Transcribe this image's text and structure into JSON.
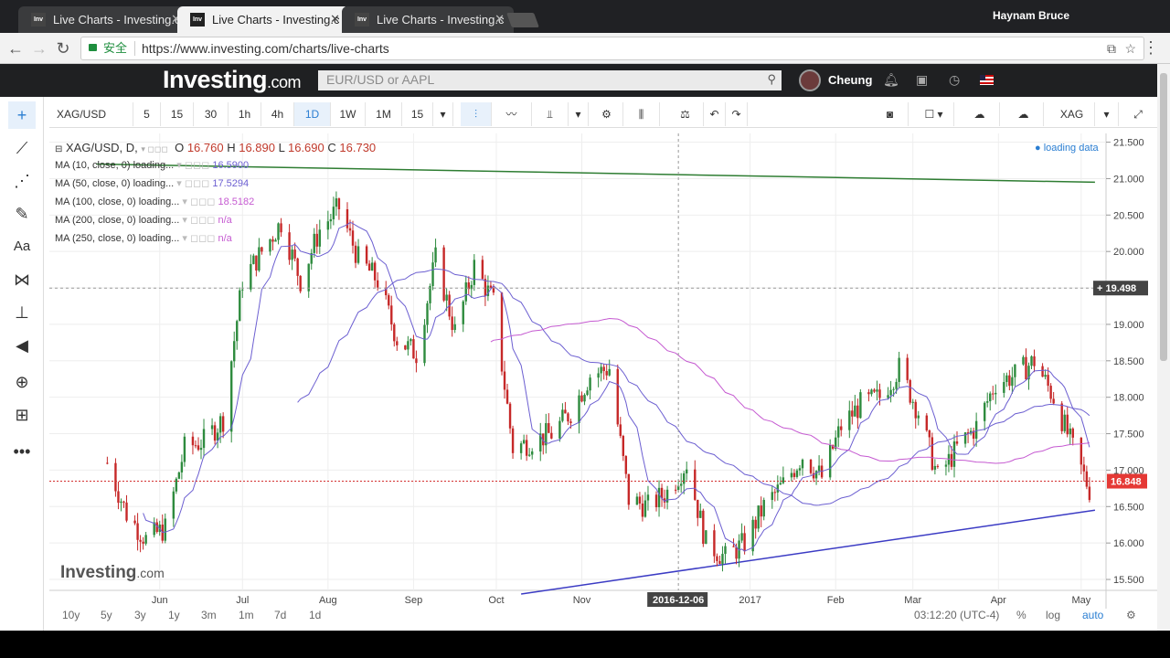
{
  "browser": {
    "tabs": [
      {
        "title": "Live Charts - Investing.c",
        "favicon": "Inv"
      },
      {
        "title": "Live Charts - Investing.c",
        "favicon": "Inv"
      },
      {
        "title": "Live Charts - Investing.c",
        "favicon": "Inv"
      }
    ],
    "active_tab": 1,
    "user": "Haynam Bruce",
    "secure_label": "安全",
    "url": "https://www.investing.com/charts/live-charts"
  },
  "site": {
    "logo_main": "Investing",
    "logo_suffix": ".com",
    "search_placeholder": "EUR/USD or AAPL",
    "username": "Cheung"
  },
  "toolbar": {
    "symbol": "XAG/USD",
    "intervals": [
      "5",
      "15",
      "30",
      "1h",
      "4h",
      "1D",
      "1W",
      "1M",
      "15"
    ],
    "active_interval": "1D",
    "symbol_right": "XAG"
  },
  "legend": {
    "title": "XAG/USD, D,",
    "ohlc": [
      {
        "label": "O",
        "value": "16.760"
      },
      {
        "label": "H",
        "value": "16.890"
      },
      {
        "label": "L",
        "value": "16.690"
      },
      {
        "label": "C",
        "value": "16.730"
      }
    ],
    "studies": [
      {
        "name": "MA (10, close, 0) loading...",
        "value": "16.5900",
        "color": "#6c5fd1"
      },
      {
        "name": "MA (50, close, 0) loading...",
        "value": "17.5294",
        "color": "#6c5fd1"
      },
      {
        "name": "MA (100, close, 0) loading...",
        "value": "18.5182",
        "color": "#c55ad1"
      },
      {
        "name": "MA (200, close, 0) loading...",
        "value": "n/a",
        "color": "#c55ad1"
      },
      {
        "name": "MA (250, close, 0) loading...",
        "value": "n/a",
        "color": "#c55ad1"
      }
    ],
    "status": "loading data"
  },
  "chart_data": {
    "type": "candlestick",
    "symbol": "XAG/USD",
    "y_ticks": [
      "21.500",
      "21.000",
      "20.500",
      "20.000",
      "19.500",
      "19.000",
      "18.500",
      "18.000",
      "17.500",
      "17.000",
      "16.500",
      "16.000",
      "15.500"
    ],
    "ylim": [
      15.35,
      21.62
    ],
    "x_ticks": [
      "Jun",
      "Jul",
      "Aug",
      "Sep",
      "Oct",
      "Nov",
      "2016-12-06",
      "2017",
      "Feb",
      "Mar",
      "Apr",
      "May"
    ],
    "crosshair_price": "19.498",
    "crosshair_date": "2016-12-06",
    "last_price": "16.848",
    "close_path": [
      [
        "2016-05-13",
        17.1
      ],
      [
        "2016-05-20",
        16.4
      ],
      [
        "2016-05-27",
        16.05
      ],
      [
        "2016-06-03",
        16.2
      ],
      [
        "2016-06-10",
        17.3
      ],
      [
        "2016-06-17",
        17.4
      ],
      [
        "2016-06-24",
        17.7
      ],
      [
        "2016-07-01",
        19.6
      ],
      [
        "2016-07-08",
        20.0
      ],
      [
        "2016-07-15",
        20.4
      ],
      [
        "2016-07-22",
        19.6
      ],
      [
        "2016-07-29",
        20.3
      ],
      [
        "2016-08-05",
        20.6
      ],
      [
        "2016-08-12",
        19.9
      ],
      [
        "2016-08-19",
        19.6
      ],
      [
        "2016-08-26",
        18.8
      ],
      [
        "2016-09-02",
        18.6
      ],
      [
        "2016-09-09",
        19.9
      ],
      [
        "2016-09-16",
        18.9
      ],
      [
        "2016-09-23",
        19.8
      ],
      [
        "2016-09-30",
        19.3
      ],
      [
        "2016-10-07",
        17.3
      ],
      [
        "2016-10-14",
        17.4
      ],
      [
        "2016-10-21",
        17.5
      ],
      [
        "2016-10-28",
        17.8
      ],
      [
        "2016-11-04",
        18.3
      ],
      [
        "2016-11-11",
        18.4
      ],
      [
        "2016-11-18",
        16.6
      ],
      [
        "2016-11-25",
        16.5
      ],
      [
        "2016-12-02",
        16.7
      ],
      [
        "2016-12-09",
        17.1
      ],
      [
        "2016-12-16",
        16.0
      ],
      [
        "2016-12-23",
        15.8
      ],
      [
        "2016-12-30",
        16.0
      ],
      [
        "2017-01-06",
        16.5
      ],
      [
        "2017-01-13",
        16.8
      ],
      [
        "2017-01-20",
        17.2
      ],
      [
        "2017-01-27",
        16.9
      ],
      [
        "2017-02-03",
        17.6
      ],
      [
        "2017-02-10",
        17.9
      ],
      [
        "2017-02-17",
        18.0
      ],
      [
        "2017-02-24",
        18.4
      ],
      [
        "2017-03-03",
        17.8
      ],
      [
        "2017-03-10",
        16.9
      ],
      [
        "2017-03-17",
        17.3
      ],
      [
        "2017-03-24",
        17.6
      ],
      [
        "2017-03-31",
        18.2
      ],
      [
        "2017-04-07",
        18.3
      ],
      [
        "2017-04-14",
        18.5
      ],
      [
        "2017-04-21",
        18.0
      ],
      [
        "2017-04-28",
        17.3
      ],
      [
        "2017-05-04",
        16.73
      ]
    ],
    "trend_line_top": [
      [
        "2016-05-09",
        21.2
      ],
      [
        "2017-05-06",
        20.95
      ]
    ],
    "trend_line_bottom": [
      [
        "2016-10-10",
        15.3
      ],
      [
        "2017-05-06",
        16.45
      ]
    ],
    "ma_lines": [
      {
        "name": "MA 10",
        "color": "#6c5fd1"
      },
      {
        "name": "MA 50",
        "color": "#6c5fd1"
      },
      {
        "name": "MA 100",
        "color": "#c55ad1"
      }
    ]
  },
  "bottom": {
    "ranges": [
      "10y",
      "5y",
      "3y",
      "1y",
      "3m",
      "1m",
      "7d",
      "1d"
    ],
    "time": "03:12:20 (UTC-4)",
    "pct": "%",
    "log": "log",
    "auto": "auto"
  },
  "watermark": {
    "main": "Investing",
    "suffix": ".com"
  }
}
